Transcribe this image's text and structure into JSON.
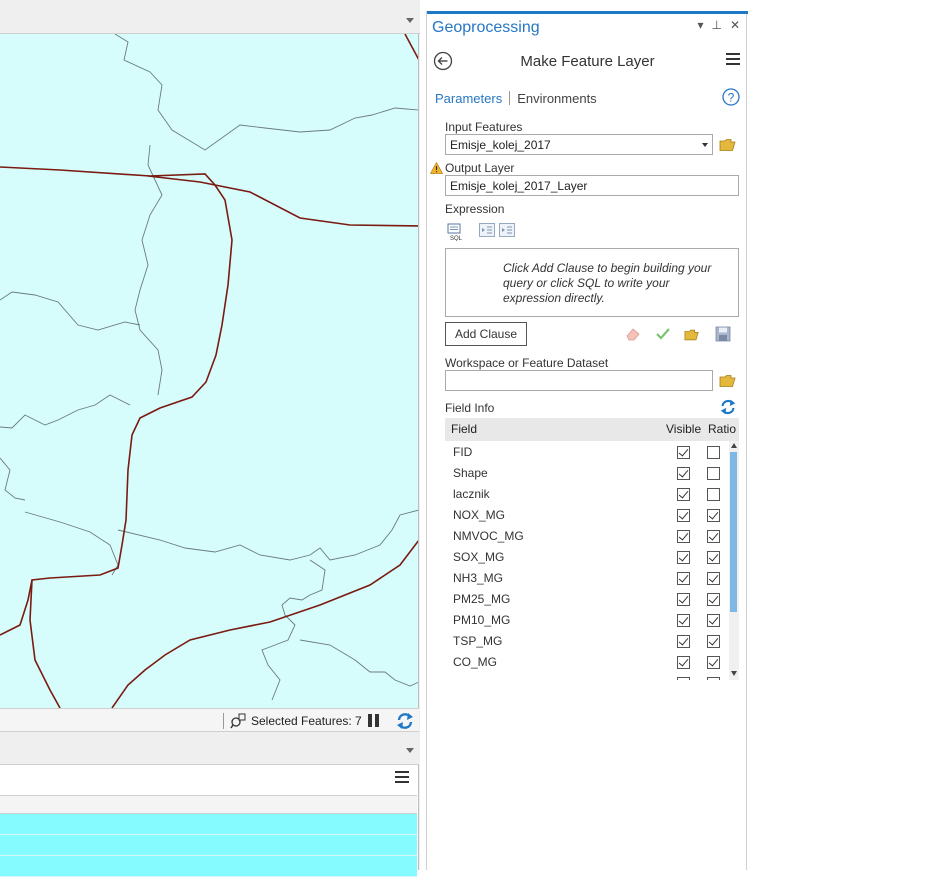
{
  "map": {
    "status": {
      "selected_features": "Selected Features: 7"
    }
  },
  "geoprocessing": {
    "title": "Geoprocessing",
    "controls": {
      "dropdown": "▾",
      "pin": "⊥",
      "close": "✕"
    },
    "tool_name": "Make Feature Layer",
    "tabs": {
      "parameters": "Parameters",
      "environments": "Environments"
    },
    "input_features": {
      "label": "Input Features",
      "value": "Emisje_kolej_2017"
    },
    "output_layer": {
      "label": "Output Layer",
      "value": "Emisje_kolej_2017_Layer"
    },
    "expression": {
      "label": "Expression",
      "hint": "Click Add Clause to begin building your query or click SQL to write your expression directly.",
      "add_clause_label": "Add Clause"
    },
    "workspace": {
      "label": "Workspace or Feature Dataset",
      "value": ""
    },
    "field_info": {
      "label": "Field Info",
      "columns": {
        "field": "Field",
        "visible": "Visible",
        "ratio": "Ratio"
      },
      "rows": [
        {
          "name": "FID",
          "visible": true,
          "ratio": false
        },
        {
          "name": "Shape",
          "visible": true,
          "ratio": false
        },
        {
          "name": "lacznik",
          "visible": true,
          "ratio": false
        },
        {
          "name": "NOX_MG",
          "visible": true,
          "ratio": true
        },
        {
          "name": "NMVOC_MG",
          "visible": true,
          "ratio": true
        },
        {
          "name": "SOX_MG",
          "visible": true,
          "ratio": true
        },
        {
          "name": "NH3_MG",
          "visible": true,
          "ratio": true
        },
        {
          "name": "PM25_MG",
          "visible": true,
          "ratio": true
        },
        {
          "name": "PM10_MG",
          "visible": true,
          "ratio": true
        },
        {
          "name": "TSP_MG",
          "visible": true,
          "ratio": true
        },
        {
          "name": "CO_MG",
          "visible": true,
          "ratio": true
        },
        {
          "name": "",
          "visible": true,
          "ratio": true
        }
      ]
    }
  },
  "colors": {
    "accent": "#1e78c8",
    "map_background": "#d6fdfc",
    "rail_line": "#7a1a10",
    "boundary_line": "#6b7b7b",
    "table_row": "#85fbff"
  }
}
